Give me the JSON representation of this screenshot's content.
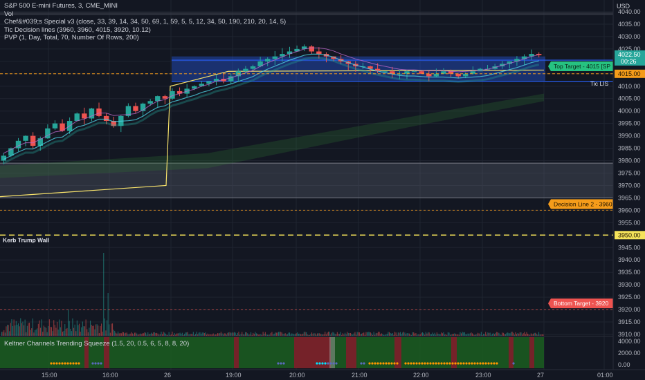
{
  "header": {
    "symbol_line": "S&P 500 E-mini Futures, 3, CME_MINI",
    "indicators": [
      "Vol",
      "Chef&#039;s Special v3 (close, 33, 39, 14, 34, 50, 69, 1, 59, 5, 5, 12, 34, 50, 190, 210, 20, 14, 5)",
      "Tic Decision lines (3960, 3960, 4015, 3920, 10.12)",
      "PVP (1, Day, Total, 70, Number Of Rows, 200)"
    ]
  },
  "axis": {
    "currency": "USD",
    "ticks": [
      4040,
      4035,
      4030,
      4025,
      4020,
      4015,
      4010,
      4005,
      4000,
      3995,
      3990,
      3985,
      3980,
      3975,
      3970,
      3965,
      3960,
      3955,
      3950,
      3945,
      3940,
      3935,
      3930,
      3925,
      3920,
      3915,
      3910
    ],
    "tick_labels": [
      "4040.00",
      "4035.00",
      "4030.00",
      "4025.00",
      "4020.00",
      "4015.00",
      "4010.00",
      "4005.00",
      "4000.00",
      "3995.00",
      "3990.00",
      "3985.00",
      "3980.00",
      "3975.00",
      "3970.00",
      "3965.00",
      "3960.00",
      "3955.00",
      "3950.00",
      "3945.00",
      "3940.00",
      "3935.00",
      "3930.00",
      "3925.00",
      "3920.00",
      "3915.00",
      "3910.00"
    ],
    "last_price_label": "4022.50",
    "countdown_label": "00:26",
    "marker_4015": "4015.00",
    "marker_3950": "3950.00"
  },
  "time_axis": {
    "labels": [
      "15:00",
      "16:00",
      "26",
      "19:00",
      "20:00",
      "21:00",
      "22:00",
      "23:00",
      "27",
      "01:00"
    ]
  },
  "levels": {
    "top_target": "Top Target - 4015 [SP",
    "tic_lis": "Tic LIS",
    "decision_line_2": "Decision Line 2 - 3960",
    "kerb_trump_wall": "Kerb Trump Wall",
    "bottom_target": "Bottom Target - 3920"
  },
  "squeeze": {
    "title": "Keltner Channels Trending Squeeze (1.5, 20, 0.5, 6, 5, 8, 8, 20)",
    "axis_labels": [
      "4000.00",
      "2000.00",
      "0.00"
    ]
  },
  "colors": {
    "background": "#131722",
    "up": "#26a69a",
    "down": "#ef5350",
    "top_target": "#26c281",
    "decision": "#f59c1a",
    "bottom_target": "#ef5350",
    "yellow_line": "#f7e26b",
    "vah_zone": "#2962ff",
    "squeeze_green": "#1b5e20",
    "squeeze_red": "#7f1d2a"
  },
  "chart_data": {
    "type": "candlestick",
    "price_range": [
      3908,
      4042
    ],
    "level_lines": [
      {
        "value": 4015,
        "label": "Top Target - 4015 [SP"
      },
      {
        "value": 3960,
        "label": "Decision Line 2 - 3960"
      },
      {
        "value": 3950,
        "label": "Kerb Trump Wall"
      },
      {
        "value": 3920,
        "label": "Bottom Target - 3920"
      }
    ],
    "candles_close": [
      3982,
      3985,
      3988,
      3990,
      3986,
      3989,
      3993,
      3995,
      3992,
      3996,
      3999,
      3997,
      4001,
      3998,
      3996,
      3994,
      3998,
      4002,
      4000,
      4003,
      4004,
      4006,
      4005,
      4008,
      4007,
      4009,
      4010,
      4011,
      4012,
      4013,
      4012,
      4014,
      4016,
      4017,
      4018,
      4020,
      4021,
      4022,
      4023,
      4024,
      4025,
      4026,
      4024,
      4023,
      4022,
      4021,
      4020,
      4019,
      4018,
      4018,
      4017,
      4016,
      4016,
      4015,
      4015,
      4016,
      4016,
      4015,
      4014,
      4015,
      4016,
      4015,
      4014,
      4015,
      4016,
      4017,
      4017,
      4018,
      4019,
      4020,
      4021,
      4022,
      4023,
      4022.5
    ]
  }
}
